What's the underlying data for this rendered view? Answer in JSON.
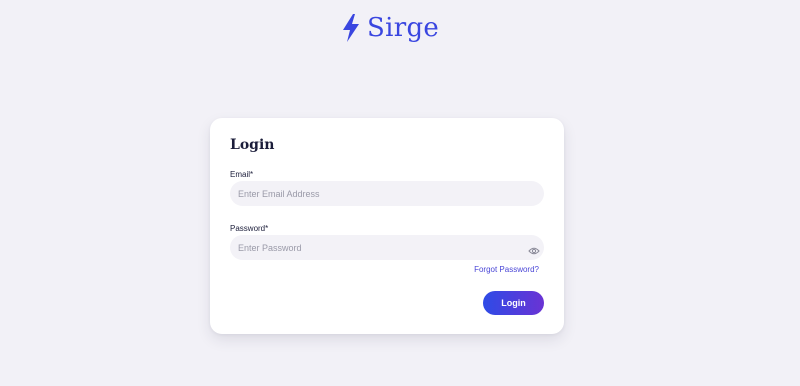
{
  "brand": {
    "name": "Sirge",
    "color": "#3a46e0",
    "icon": "lightning-bolt-icon"
  },
  "login_card": {
    "title": "Login",
    "email": {
      "label": "Email*",
      "placeholder": "Enter Email Address",
      "value": ""
    },
    "password": {
      "label": "Password*",
      "placeholder": "Enter Password",
      "value": "",
      "toggle_icon": "eye-icon"
    },
    "forgot_password": "Forgot Password?",
    "login_button": "Login",
    "button_gradient": [
      "#2e4be6",
      "#6a33d4"
    ]
  }
}
